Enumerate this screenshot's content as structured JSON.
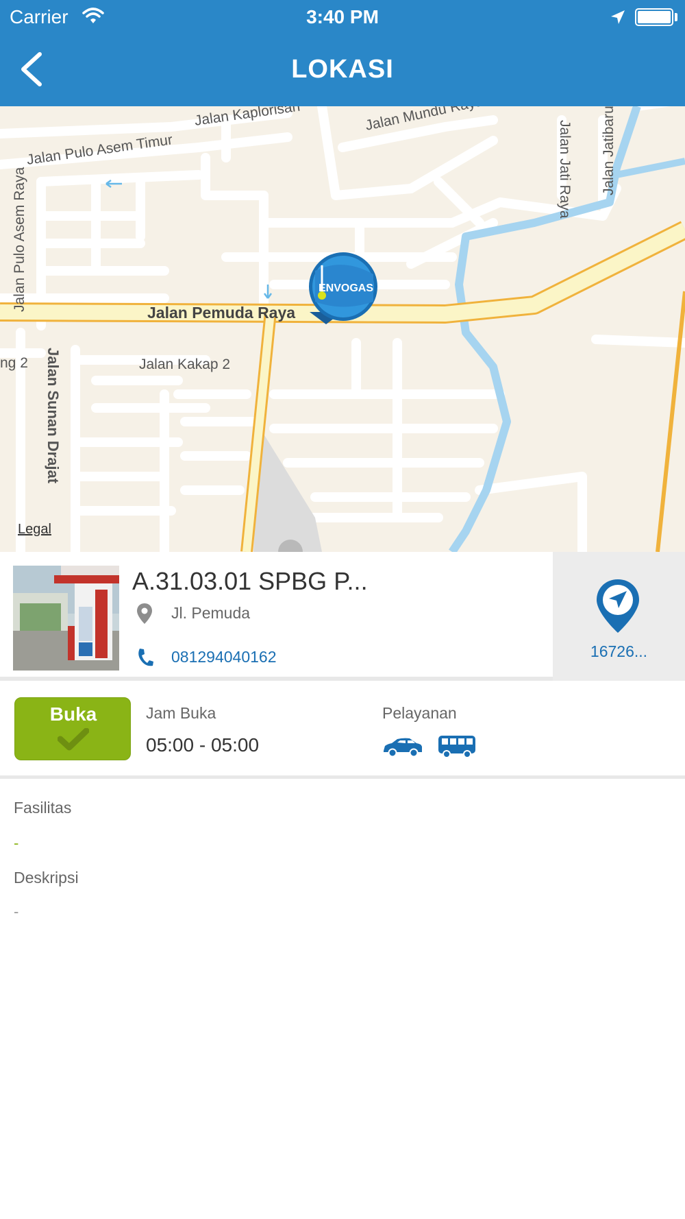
{
  "status_bar": {
    "carrier": "Carrier",
    "time": "3:40 PM",
    "icons": [
      "wifi-icon",
      "location-arrow-icon",
      "battery-icon"
    ]
  },
  "nav": {
    "title": "LOKASI",
    "back_icon": "chevron-left-icon"
  },
  "map": {
    "legal": "Legal",
    "marker_label": "ENVOGAS",
    "street_labels": [
      "Jalan Kaplorisan",
      "Jalan Mundu Raya",
      "Jalan Pulo Asem Timur",
      "Jalan Jati Raya",
      "Jalan Jatibaru",
      "Jalan Pulo Asem Raya",
      "Jalan Pemuda Raya",
      "Jalan Kakap 2",
      "Jalan Sunan Drajat",
      "ng 2"
    ]
  },
  "station": {
    "name": "A.31.03.01 SPBG P...",
    "address": "Jl. Pemuda",
    "phone": "081294040162",
    "distance": "16726..."
  },
  "hours": {
    "status_label": "Buka",
    "jam_label": "Jam Buka",
    "jam_value": "05:00 - 05:00",
    "layanan_label": "Pelayanan",
    "service_icons": [
      "car-icon",
      "bus-icon"
    ]
  },
  "details": {
    "fasilitas_label": "Fasilitas",
    "fasilitas_value": "-",
    "deskripsi_label": "Deskripsi",
    "deskripsi_value": "-"
  },
  "colors": {
    "header": "#2a87c8",
    "open_badge": "#8ab416",
    "link": "#1a6fb3",
    "map_bg": "#f6f1e7",
    "main_road": "#fbf5c7",
    "main_road_border": "#f0b23c",
    "river": "#a6d4f0"
  }
}
